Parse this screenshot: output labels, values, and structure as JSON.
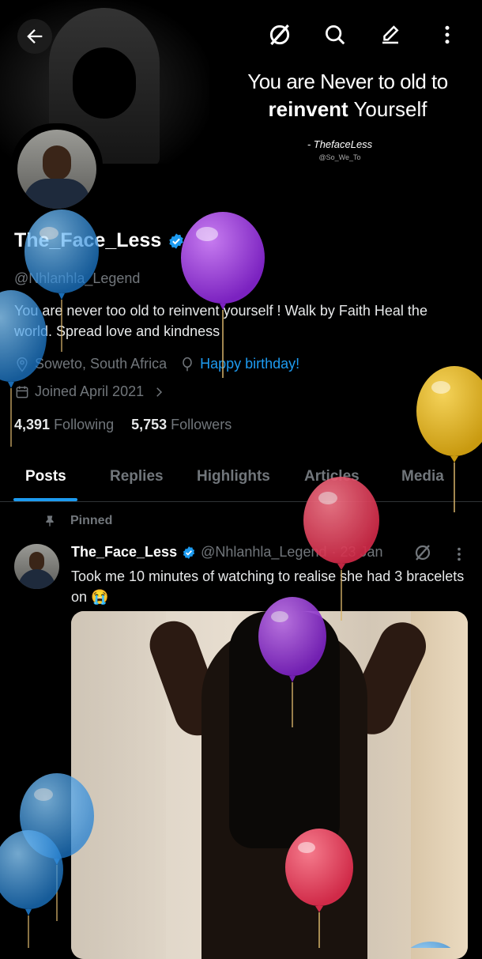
{
  "header": {
    "back_icon": "arrow-left-icon",
    "actions": [
      "grok-icon",
      "search-icon",
      "compose-icon",
      "more-vertical-icon"
    ]
  },
  "banner": {
    "quote_line1": "You are Never to old to",
    "quote_bold": "reinvent",
    "quote_rest": " Yourself",
    "signature": "- ThefaceLess",
    "signature_handle": "@So_We_To"
  },
  "profile": {
    "name": "The_Face_Less",
    "verified_icon": "verified-badge-icon",
    "handle": "@Nhlanhla_Legend",
    "bio": "You are never too old to reinvent yourself ! Walk by Faith Heal the world. Spread love and kindness",
    "location": "Soweto, South Africa",
    "birthday": "Happy birthday!",
    "joined": "Joined April 2021",
    "following_count": "4,391",
    "following_label": "Following",
    "followers_count": "5,753",
    "followers_label": "Followers"
  },
  "tabs": [
    {
      "label": "Posts",
      "active": true
    },
    {
      "label": "Replies"
    },
    {
      "label": "Highlights"
    },
    {
      "label": "Articles"
    },
    {
      "label": "Media"
    }
  ],
  "pinned_post": {
    "pinned_label": "Pinned",
    "author": "The_Face_Less",
    "handle": "@Nhlanhla_Legend",
    "date": "· 23 Jan",
    "text": "Took me 10 minutes of watching to realise she had 3 bracelets on 😭"
  },
  "colors": {
    "accent": "#1d9bf0",
    "balloon_blue": "#3d9be9",
    "balloon_purple": "#9b3fd6",
    "balloon_yellow": "#e0b020",
    "balloon_red": "#e0405a"
  }
}
